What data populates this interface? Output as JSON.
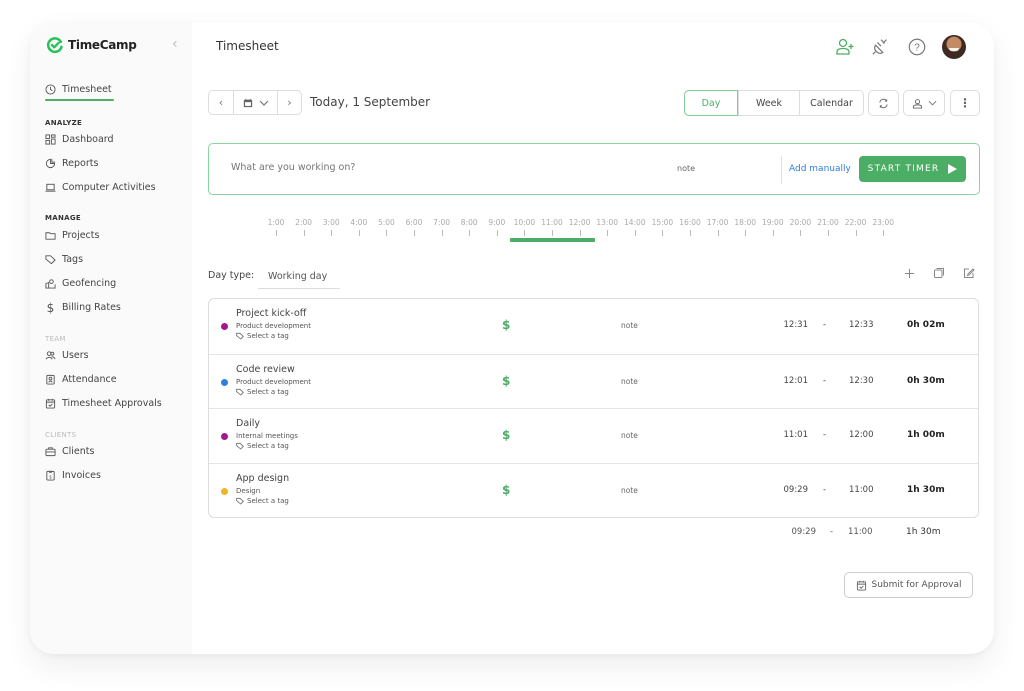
{
  "app": {
    "name": "TimeCamp",
    "brand_color": "#4cad64",
    "link_color": "#2f7fe0"
  },
  "sidebar": {
    "collapse_icon": "chevron-left-icon",
    "active_item": {
      "label": "Timesheet",
      "icon": "clock-icon"
    },
    "sections": [
      {
        "label": "ANALYZE",
        "items": [
          {
            "label": "Dashboard",
            "icon": "dashboard-icon"
          },
          {
            "label": "Reports",
            "icon": "reports-icon"
          },
          {
            "label": "Computer Activities",
            "icon": "laptop-icon"
          }
        ]
      },
      {
        "label": "MANAGE",
        "items": [
          {
            "label": "Projects",
            "icon": "folder-icon"
          },
          {
            "label": "Tags",
            "icon": "tag-icon"
          },
          {
            "label": "Geofencing",
            "icon": "map-icon"
          },
          {
            "label": "Billing Rates",
            "icon": "dollar-icon"
          }
        ]
      },
      {
        "label": "TEAM",
        "items": [
          {
            "label": "Users",
            "icon": "users-icon"
          },
          {
            "label": "Attendance",
            "icon": "badge-icon"
          },
          {
            "label": "Timesheet Approvals",
            "icon": "calendar-check-icon"
          }
        ]
      },
      {
        "label": "CLIENTS",
        "items": [
          {
            "label": "Clients",
            "icon": "briefcase-icon"
          },
          {
            "label": "Invoices",
            "icon": "invoice-icon"
          }
        ]
      }
    ]
  },
  "header": {
    "title": "Timesheet",
    "icons": [
      "add-user-icon",
      "plug-icon",
      "help-icon",
      "avatar"
    ]
  },
  "date_nav": {
    "label": "Today, 1 September",
    "prev_icon": "chevron-left-icon",
    "calendar_icon": "calendar-icon",
    "next_icon": "chevron-right-icon"
  },
  "view_tabs": [
    {
      "label": "Day",
      "active": true
    },
    {
      "label": "Week",
      "active": false
    },
    {
      "label": "Calendar",
      "active": false
    }
  ],
  "toolbar": {
    "refresh_icon": "refresh-icon",
    "user_filter_icon": "user-icon",
    "more_icon": "more-vertical-icon"
  },
  "timer": {
    "placeholder": "What are you working on?",
    "note_label": "note",
    "add_manually": "Add manually",
    "start_label": "START TIMER"
  },
  "timeline": {
    "hours": [
      "1:00",
      "2:00",
      "3:00",
      "4:00",
      "5:00",
      "6:00",
      "7:00",
      "8:00",
      "9:00",
      "10:00",
      "11:00",
      "12:00",
      "13:00",
      "14:00",
      "15:00",
      "16:00",
      "17:00",
      "18:00",
      "19:00",
      "20:00",
      "21:00",
      "22:00",
      "23:00"
    ],
    "tracked_range": {
      "start_hour": 9.48,
      "end_hour": 12.55
    }
  },
  "day_type": {
    "label": "Day type:",
    "value": "Working day"
  },
  "row_tools": [
    "plus-icon",
    "copy-icon",
    "edit-icon"
  ],
  "entries": [
    {
      "title": "Project kick-off",
      "project": "Product development",
      "color": "#a2198f",
      "tag": "Select a tag",
      "billable": "$",
      "note": "note",
      "start": "12:31",
      "end": "12:33",
      "duration": "0h 02m"
    },
    {
      "title": "Code review",
      "project": "Product development",
      "color": "#2f7fe0",
      "tag": "Select a tag",
      "billable": "$",
      "note": "note",
      "start": "12:01",
      "end": "12:30",
      "duration": "0h 30m"
    },
    {
      "title": "Daily",
      "project": "Internal meetings",
      "color": "#a2198f",
      "tag": "Select a tag",
      "billable": "$",
      "note": "note",
      "start": "11:01",
      "end": "12:00",
      "duration": "1h 00m"
    },
    {
      "title": "App design",
      "project": "Design",
      "color": "#f0b428",
      "tag": "Select a tag",
      "billable": "$",
      "note": "note",
      "start": "09:29",
      "end": "11:00",
      "duration": "1h 30m"
    }
  ],
  "totals": {
    "start": "09:29",
    "dash": "-",
    "end": "11:00",
    "duration": "1h 30m"
  },
  "submit": {
    "label": "Submit for Approval",
    "icon": "calendar-check-icon"
  }
}
